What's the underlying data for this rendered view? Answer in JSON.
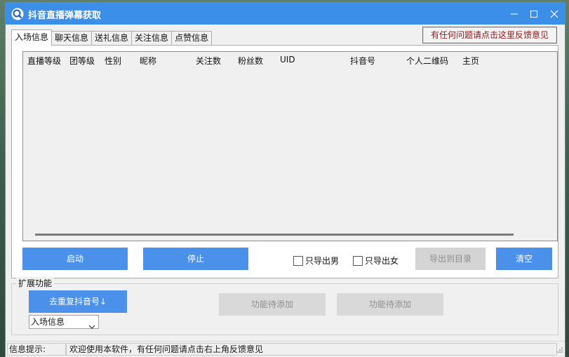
{
  "window": {
    "title": "抖音直播弹幕获取"
  },
  "tabs": [
    {
      "label": "入场信息",
      "active": true
    },
    {
      "label": "聊天信息",
      "active": false
    },
    {
      "label": "送礼信息",
      "active": false
    },
    {
      "label": "关注信息",
      "active": false
    },
    {
      "label": "点赞信息",
      "active": false
    }
  ],
  "feedback_button": "有任何问题请点击这里反馈意见",
  "table": {
    "columns": [
      "直播等级",
      "团等级",
      "性别",
      "昵称",
      "关注数",
      "粉丝数",
      "UID",
      "抖音号",
      "个人二维码",
      "主页"
    ],
    "rows": []
  },
  "controls": {
    "start": "启动",
    "stop": "停止",
    "only_male": "只导出男",
    "only_female": "只导出女",
    "export": "导出到目录",
    "clear": "清空"
  },
  "extension": {
    "title": "扩展功能",
    "dedupe_button": "去重复抖音号↓",
    "placeholder_1": "功能待添加",
    "placeholder_2": "功能待添加",
    "select_value": "入场信息"
  },
  "status": {
    "label": "信息提示:",
    "message": "欢迎使用本软件，有任何问题请点击右上角反馈意见"
  },
  "colors": {
    "titlebar": "#3c8fe6",
    "primary_button": "#4b91ea",
    "disabled_button": "#d4d4d4",
    "feedback_text": "#8b1a1a"
  }
}
